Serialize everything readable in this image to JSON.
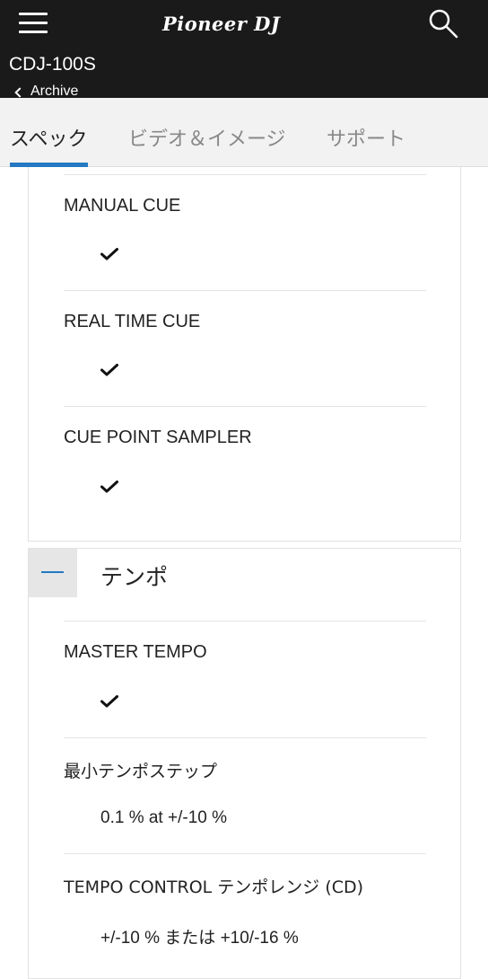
{
  "header": {
    "brand": "Pioneer DJ",
    "model": "CDJ-100S",
    "back_label": "Archive"
  },
  "tabs": [
    {
      "label": "スペック",
      "active": true
    },
    {
      "label": "ビデオ＆イメージ",
      "active": false
    },
    {
      "label": "サポート",
      "active": false
    }
  ],
  "cue_section": {
    "items": [
      {
        "label": "MANUAL CUE",
        "value": "check"
      },
      {
        "label": "REAL TIME CUE",
        "value": "check"
      },
      {
        "label": "CUE POINT SAMPLER",
        "value": "check"
      }
    ]
  },
  "tempo_section": {
    "title": "テンポ",
    "items": [
      {
        "label": "MASTER TEMPO",
        "value": "check"
      },
      {
        "label": "最小テンポステップ",
        "value": "0.1 % at +/-10 %"
      },
      {
        "label": "TEMPO CONTROL テンポレンジ (CD)",
        "value": "+/-10 % または +10/-16 %"
      }
    ]
  },
  "colors": {
    "header_bg": "#1a1a1a",
    "accent": "#2479c2",
    "tab_bar_bg": "#f2f2f2"
  }
}
